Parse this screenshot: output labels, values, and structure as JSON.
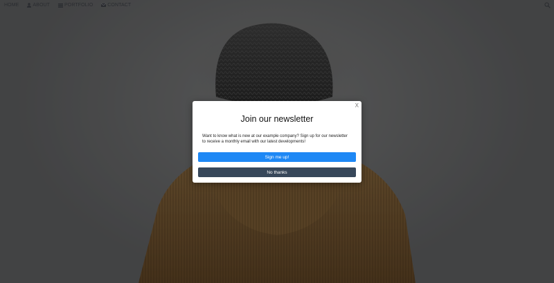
{
  "navbar": {
    "items": [
      {
        "label": "HOME",
        "icon": "none"
      },
      {
        "label": "ABOUT",
        "icon": "user-icon"
      },
      {
        "label": "PORTFOLIO",
        "icon": "th-icon"
      },
      {
        "label": "CONTACT",
        "icon": "envelope-icon"
      }
    ],
    "search_icon": "search-icon"
  },
  "modal": {
    "close_label": "X",
    "title": "Join our newsletter",
    "body": "Want to know what is new at our example company? Sign up for our newsletter to receive a monthly email with our latest developments!",
    "primary_button": "Sign me up!",
    "secondary_button": "No thanks"
  },
  "colors": {
    "primary": "#1e88f5",
    "secondary": "#37475a",
    "overlay": "rgba(0,0,0,0.38)"
  }
}
